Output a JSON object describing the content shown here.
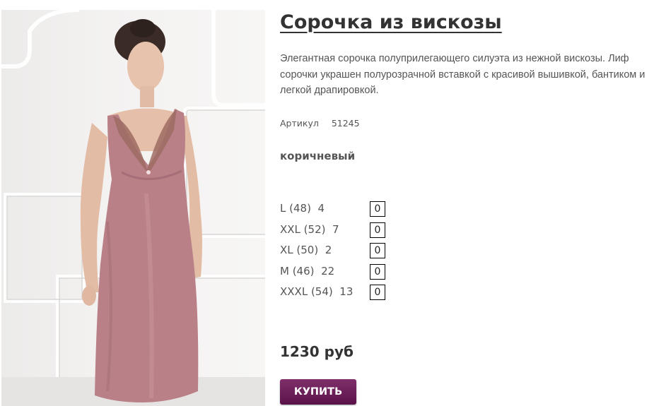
{
  "product": {
    "title": "Сорочка из вискозы",
    "description": "Элегантная сорочка полуприлегающего силуэта из нежной вискозы. Лиф сорочки украшен полурозрачной вставкой с красивой вышивкой, бантиком и легкой драпировкой.",
    "article_label": "Артикул",
    "article_number": "51245",
    "color_name": "коричневый",
    "sizes": [
      {
        "label": "L (48)",
        "stock": "4",
        "quantity": "0"
      },
      {
        "label": "XXL (52)",
        "stock": "7",
        "quantity": "0"
      },
      {
        "label": "XL (50)",
        "stock": "2",
        "quantity": "0"
      },
      {
        "label": "M (46)",
        "stock": "22",
        "quantity": "0"
      },
      {
        "label": "XXXL (54)",
        "stock": "13",
        "quantity": "0"
      }
    ],
    "price": "1230 руб",
    "buy_label": "КУПИТЬ"
  },
  "colors": {
    "dress": "#b98088",
    "button": "#6b1f5a"
  }
}
